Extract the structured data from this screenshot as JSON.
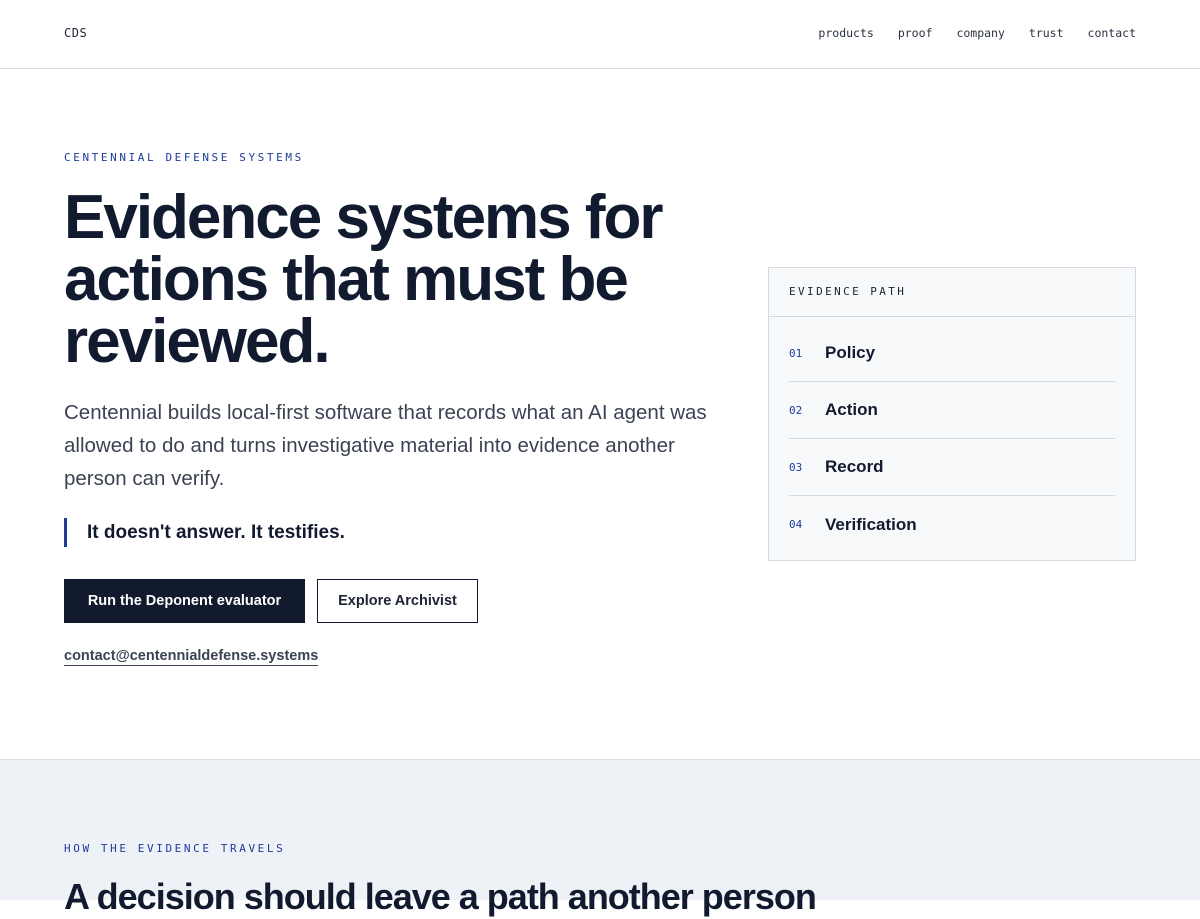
{
  "header": {
    "brand": "CDS",
    "nav": [
      "products",
      "proof",
      "company",
      "trust",
      "contact"
    ]
  },
  "hero": {
    "eyebrow": "CENTENNIAL DEFENSE SYSTEMS",
    "headline": "Evidence systems for actions that must be reviewed.",
    "lede": "Centennial builds local-first software that records what an AI agent was allowed to do and turns investigative material into evidence another person can verify.",
    "quote": "It doesn't answer. It testifies.",
    "primary_button": "Run the Deponent evaluator",
    "secondary_button": "Explore Archivist",
    "email": "contact@centennialdefense.systems"
  },
  "evidence_panel": {
    "title": "EVIDENCE PATH",
    "steps": [
      {
        "num": "01",
        "label": "Policy"
      },
      {
        "num": "02",
        "label": "Action"
      },
      {
        "num": "03",
        "label": "Record"
      },
      {
        "num": "04",
        "label": "Verification"
      }
    ]
  },
  "section2": {
    "eyebrow": "HOW THE EVIDENCE TRAVELS",
    "title": "A decision should leave a path another person"
  },
  "colors": {
    "accent": "#1d3c9a",
    "ink": "#111a2e",
    "primary_button_bg": "#121b2e",
    "section_bg": "#eef1f5"
  }
}
